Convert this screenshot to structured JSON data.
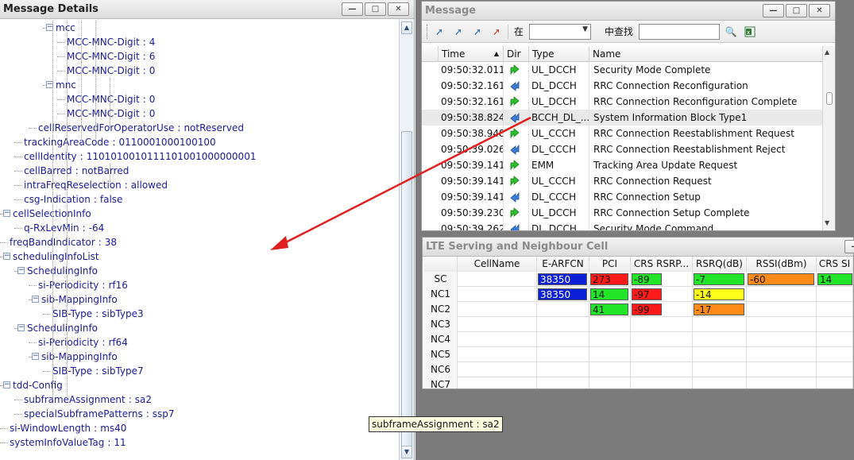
{
  "left_panel": {
    "title": "Message Details",
    "tree": [
      {
        "depth": 5,
        "key": "mcc",
        "value": null,
        "expander": "-"
      },
      {
        "depth": 6,
        "key": "MCC-MNC-Digit",
        "value": "4"
      },
      {
        "depth": 6,
        "key": "MCC-MNC-Digit",
        "value": "6"
      },
      {
        "depth": 6,
        "key": "MCC-MNC-Digit",
        "value": "0"
      },
      {
        "depth": 5,
        "key": "mnc",
        "value": null,
        "expander": "-"
      },
      {
        "depth": 6,
        "key": "MCC-MNC-Digit",
        "value": "0"
      },
      {
        "depth": 6,
        "key": "MCC-MNC-Digit",
        "value": "0"
      },
      {
        "depth": 4,
        "key": "cellReservedForOperatorUse",
        "value": "notReserved"
      },
      {
        "depth": 3,
        "key": "trackingAreaCode",
        "value": "0110001000100100"
      },
      {
        "depth": 3,
        "key": "cellIdentity",
        "value": "1101010010111101001000000001"
      },
      {
        "depth": 3,
        "key": "cellBarred",
        "value": "notBarred"
      },
      {
        "depth": 3,
        "key": "intraFreqReselection",
        "value": "allowed"
      },
      {
        "depth": 3,
        "key": "csg-Indication",
        "value": "false"
      },
      {
        "depth": 2,
        "key": "cellSelectionInfo",
        "value": null,
        "expander": "-"
      },
      {
        "depth": 3,
        "key": "q-RxLevMin",
        "value": "-64"
      },
      {
        "depth": 2,
        "key": "freqBandIndicator",
        "value": "38"
      },
      {
        "depth": 2,
        "key": "schedulingInfoList",
        "value": null,
        "expander": "-"
      },
      {
        "depth": 3,
        "key": "SchedulingInfo",
        "value": null,
        "expander": "-"
      },
      {
        "depth": 4,
        "key": "si-Periodicity",
        "value": "rf16"
      },
      {
        "depth": 4,
        "key": "sib-MappingInfo",
        "value": null,
        "expander": "-"
      },
      {
        "depth": 5,
        "key": "SIB-Type",
        "value": "sibType3"
      },
      {
        "depth": 3,
        "key": "SchedulingInfo",
        "value": null,
        "expander": "-"
      },
      {
        "depth": 4,
        "key": "si-Periodicity",
        "value": "rf64"
      },
      {
        "depth": 4,
        "key": "sib-MappingInfo",
        "value": null,
        "expander": "-"
      },
      {
        "depth": 5,
        "key": "SIB-Type",
        "value": "sibType7"
      },
      {
        "depth": 2,
        "key": "tdd-Config",
        "value": null,
        "expander": "-"
      },
      {
        "depth": 3,
        "key": "subframeAssignment",
        "value": "sa2"
      },
      {
        "depth": 3,
        "key": "specialSubframePatterns",
        "value": "ssp7"
      },
      {
        "depth": 2,
        "key": "si-WindowLength",
        "value": "ms40"
      },
      {
        "depth": 2,
        "key": "systemInfoValueTag",
        "value": "11"
      }
    ],
    "separator": ":"
  },
  "message_window": {
    "title": "Message",
    "toolbar": {
      "in_label": "在",
      "find_label": "中查找",
      "search_icon": "magnifier-icon",
      "export_icon": "excel-icon"
    },
    "columns": [
      "Time",
      "Dir",
      "Type",
      "Name"
    ],
    "rows": [
      {
        "time": "09:50:32.011",
        "dir": "up",
        "type": "UL_DCCH",
        "name": "Security Mode Complete"
      },
      {
        "time": "09:50:32.161",
        "dir": "down",
        "type": "DL_DCCH",
        "name": "RRC Connection Reconfiguration"
      },
      {
        "time": "09:50:32.161",
        "dir": "up",
        "type": "UL_DCCH",
        "name": "RRC Connection Reconfiguration Complete"
      },
      {
        "time": "09:50:38.824",
        "dir": "down",
        "type": "BCCH_DL_...",
        "name": "System Information Block Type1",
        "selected": true
      },
      {
        "time": "09:50:38.948",
        "dir": "up",
        "type": "UL_CCCH",
        "name": "RRC Connection Reestablishment Request"
      },
      {
        "time": "09:50:39.026",
        "dir": "down",
        "type": "DL_CCCH",
        "name": "RRC Connection Reestablishment Reject"
      },
      {
        "time": "09:50:39.141",
        "dir": "up",
        "type": "EMM",
        "name": "Tracking Area Update Request"
      },
      {
        "time": "09:50:39.141",
        "dir": "up",
        "type": "UL_CCCH",
        "name": "RRC Connection Request"
      },
      {
        "time": "09:50:39.141",
        "dir": "down",
        "type": "DL_CCCH",
        "name": "RRC Connection Setup"
      },
      {
        "time": "09:50:39.230",
        "dir": "up",
        "type": "UL_DCCH",
        "name": "RRC Connection Setup Complete"
      },
      {
        "time": "09:50:39.262",
        "dir": "down",
        "type": "DL_DCCH",
        "name": "Security Mode Command"
      }
    ]
  },
  "lte_window": {
    "title": "LTE Serving and Neighbour Cell",
    "columns": [
      "",
      "CellName",
      "E-ARFCN",
      "PCI",
      "CRS RSRP...",
      "RSRQ(dB)",
      "RSSI(dBm)",
      "CRS SI"
    ],
    "rows": [
      {
        "label": "SC",
        "earfcn": "38350",
        "pci": "273",
        "rsrp": "-89",
        "rsrq": "-7",
        "rssi": "-60",
        "sinr": "14"
      },
      {
        "label": "NC1",
        "earfcn": "38350",
        "pci": "14",
        "rsrp": "-97",
        "rsrq": "-14",
        "rssi": "",
        "sinr": ""
      },
      {
        "label": "NC2",
        "earfcn": "",
        "pci": "41",
        "rsrp": "-99",
        "rsrq": "-17",
        "rssi": "",
        "sinr": ""
      },
      {
        "label": "NC3",
        "earfcn": "",
        "pci": "",
        "rsrp": "",
        "rsrq": "",
        "rssi": "",
        "sinr": ""
      },
      {
        "label": "NC4",
        "earfcn": "",
        "pci": "",
        "rsrp": "",
        "rsrq": "",
        "rssi": "",
        "sinr": ""
      },
      {
        "label": "NC5",
        "earfcn": "",
        "pci": "",
        "rsrp": "",
        "rsrq": "",
        "rssi": "",
        "sinr": ""
      },
      {
        "label": "NC6",
        "earfcn": "",
        "pci": "",
        "rsrp": "",
        "rsrq": "",
        "rssi": "",
        "sinr": ""
      },
      {
        "label": "NC7",
        "earfcn": "",
        "pci": "",
        "rsrp": "",
        "rsrq": "",
        "rssi": "",
        "sinr": ""
      }
    ],
    "colors": {
      "blue": "#0a1fd6",
      "red": "#ff1a1a",
      "green": "#22e52a",
      "yellow": "#ffff1a",
      "orange": "#ff8c1a"
    },
    "cell_colors": {
      "SC": {
        "earfcn": "blue",
        "pci": "red",
        "rsrp": "green",
        "rsrq": "green",
        "rssi": "orange",
        "sinr": "green"
      },
      "NC1": {
        "earfcn": "blue",
        "pci": "green",
        "rsrp": "red",
        "rsrq": "yellow"
      },
      "NC2": {
        "pci": "green",
        "rsrp": "red",
        "rsrq": "orange"
      }
    }
  },
  "tooltip": {
    "text": "subframeAssignment : sa2"
  },
  "annotation": {
    "color": "#e02020"
  }
}
